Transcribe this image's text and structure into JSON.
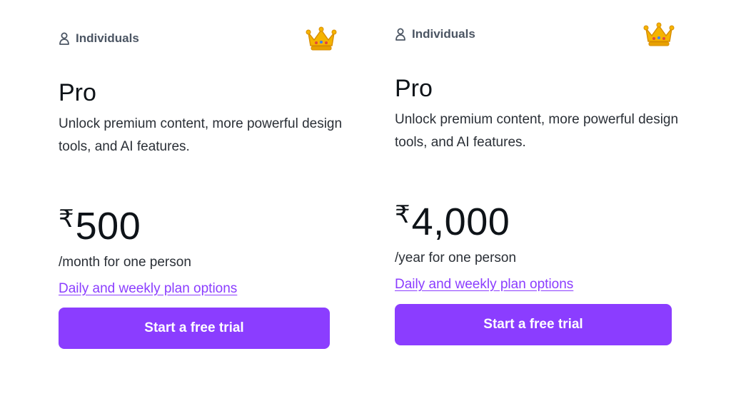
{
  "colors": {
    "accent": "#8b3dff",
    "text": "#0e1318",
    "muted": "#4b5563",
    "crown": "#f5b400"
  },
  "plans": [
    {
      "audience": "Individuals",
      "audience_icon": "person-icon",
      "badge_icon": "crown-icon",
      "name": "Pro",
      "description": "Unlock premium content, more powerful design tools, and AI features.",
      "currency": "₹",
      "price": "500",
      "period": "/month for one person",
      "link": "Daily and weekly plan options",
      "cta": "Start a free trial"
    },
    {
      "audience": "Individuals",
      "audience_icon": "person-icon",
      "badge_icon": "crown-icon",
      "name": "Pro",
      "description": "Unlock premium content, more powerful design tools, and AI features.",
      "currency": "₹",
      "price": "4,000",
      "period": "/year for one person",
      "link": "Daily and weekly plan options",
      "cta": "Start a free trial"
    }
  ]
}
